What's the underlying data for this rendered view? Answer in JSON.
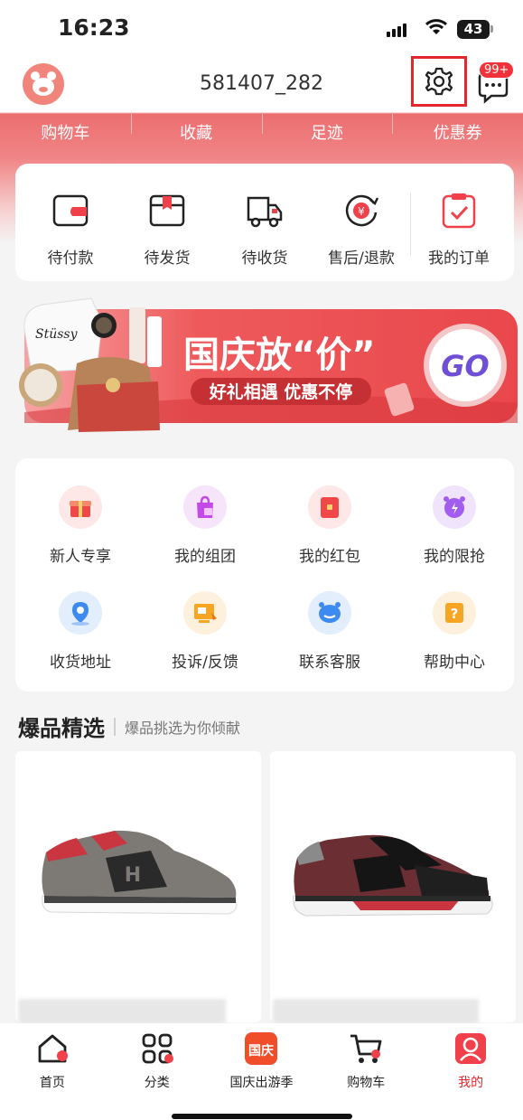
{
  "status_bar": {
    "time": "16:23",
    "battery": "43"
  },
  "header": {
    "username": "581407_282",
    "message_badge": "99+"
  },
  "quick_tabs": [
    "购物车",
    "收藏",
    "足迹",
    "优惠券"
  ],
  "orders": [
    {
      "label": "待付款",
      "icon": "wallet-icon"
    },
    {
      "label": "待发货",
      "icon": "package-icon"
    },
    {
      "label": "待收货",
      "icon": "truck-icon"
    },
    {
      "label": "售后/退款",
      "icon": "refund-icon"
    },
    {
      "label": "我的订单",
      "icon": "order-clipboard-icon"
    }
  ],
  "banner": {
    "title": "国庆放“价”",
    "subtitle": "好礼相遇 优惠不停",
    "go_label": "GO"
  },
  "services": [
    {
      "label": "新人专享",
      "icon": "gift-icon"
    },
    {
      "label": "我的组团",
      "icon": "group-bag-icon"
    },
    {
      "label": "我的红包",
      "icon": "red-envelope-icon"
    },
    {
      "label": "我的限抢",
      "icon": "alarm-clock-icon"
    },
    {
      "label": "收货地址",
      "icon": "location-icon"
    },
    {
      "label": "投诉/反馈",
      "icon": "feedback-icon"
    },
    {
      "label": "联系客服",
      "icon": "customer-service-icon"
    },
    {
      "label": "帮助中心",
      "icon": "help-icon"
    }
  ],
  "section": {
    "title": "爆品精选",
    "subtitle": "爆品挑选为你倾献"
  },
  "tabbar": [
    {
      "label": "首页",
      "icon": "home-icon"
    },
    {
      "label": "分类",
      "icon": "category-icon"
    },
    {
      "label": "国庆出游季",
      "icon": "guoqing-icon"
    },
    {
      "label": "购物车",
      "icon": "cart-icon"
    },
    {
      "label": "我的",
      "icon": "profile-icon"
    }
  ],
  "colors": {
    "brand": "#ec6e6f",
    "accent": "#e5262c"
  }
}
